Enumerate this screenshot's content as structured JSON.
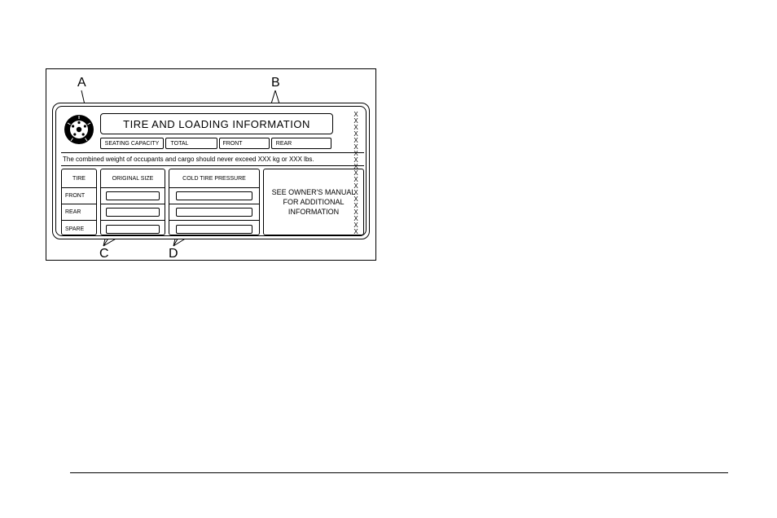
{
  "callouts": {
    "A": "A",
    "B": "B",
    "C": "C",
    "D": "D"
  },
  "placard": {
    "title": "TIRE AND LOADING INFORMATION",
    "seating": {
      "caption": "SEATING CAPACITY",
      "total_label": "TOTAL",
      "total_value": "",
      "front_label": "FRONT",
      "front_value": "",
      "rear_label": "REAR",
      "rear_value": ""
    },
    "weight_line": "The combined weight of occupants and cargo should never exceed  XXX kg or XXX lbs.",
    "table": {
      "headers": {
        "tire": "TIRE",
        "size": "ORIGINAL SIZE",
        "pressure": "COLD TIRE PRESSURE"
      },
      "rows": [
        {
          "label": "FRONT",
          "size": "",
          "pressure": ""
        },
        {
          "label": "REAR",
          "size": "",
          "pressure": ""
        },
        {
          "label": "SPARE",
          "size": "",
          "pressure": ""
        }
      ],
      "note": "SEE OWNER'S MANUAL FOR ADDITIONAL INFORMATION"
    },
    "x_marks": [
      "X",
      "X",
      "X",
      "X",
      "X",
      "X",
      "X",
      "X",
      "X",
      "X",
      "X",
      "X",
      "X",
      "X",
      "X",
      "X",
      "X",
      "X",
      "X"
    ]
  }
}
